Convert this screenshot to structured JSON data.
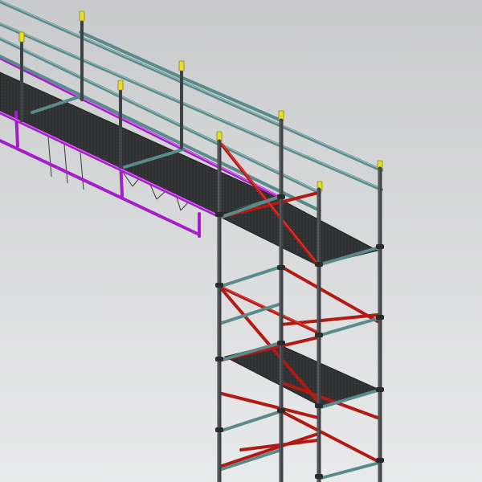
{
  "scene": {
    "kind": "3d-render",
    "subject": "scaffolding",
    "colors": {
      "background_top": "#c9cacb",
      "background_bottom": "#e9eaeb",
      "standard": "#3f4244",
      "standard_highlight": "#6a6e70",
      "ledger": "#5a8a8c",
      "ledger_highlight": "#9cc3c4",
      "brace": "#b21a14",
      "brace_highlight": "#e24a40",
      "bridge_frame": "#a41fc8",
      "bridge_highlight": "#e07af5",
      "deck": "#2f3133",
      "deck_edge": "#5a8a8c",
      "cap": "#e6df2a",
      "coupler": "#2a2b2c"
    }
  }
}
